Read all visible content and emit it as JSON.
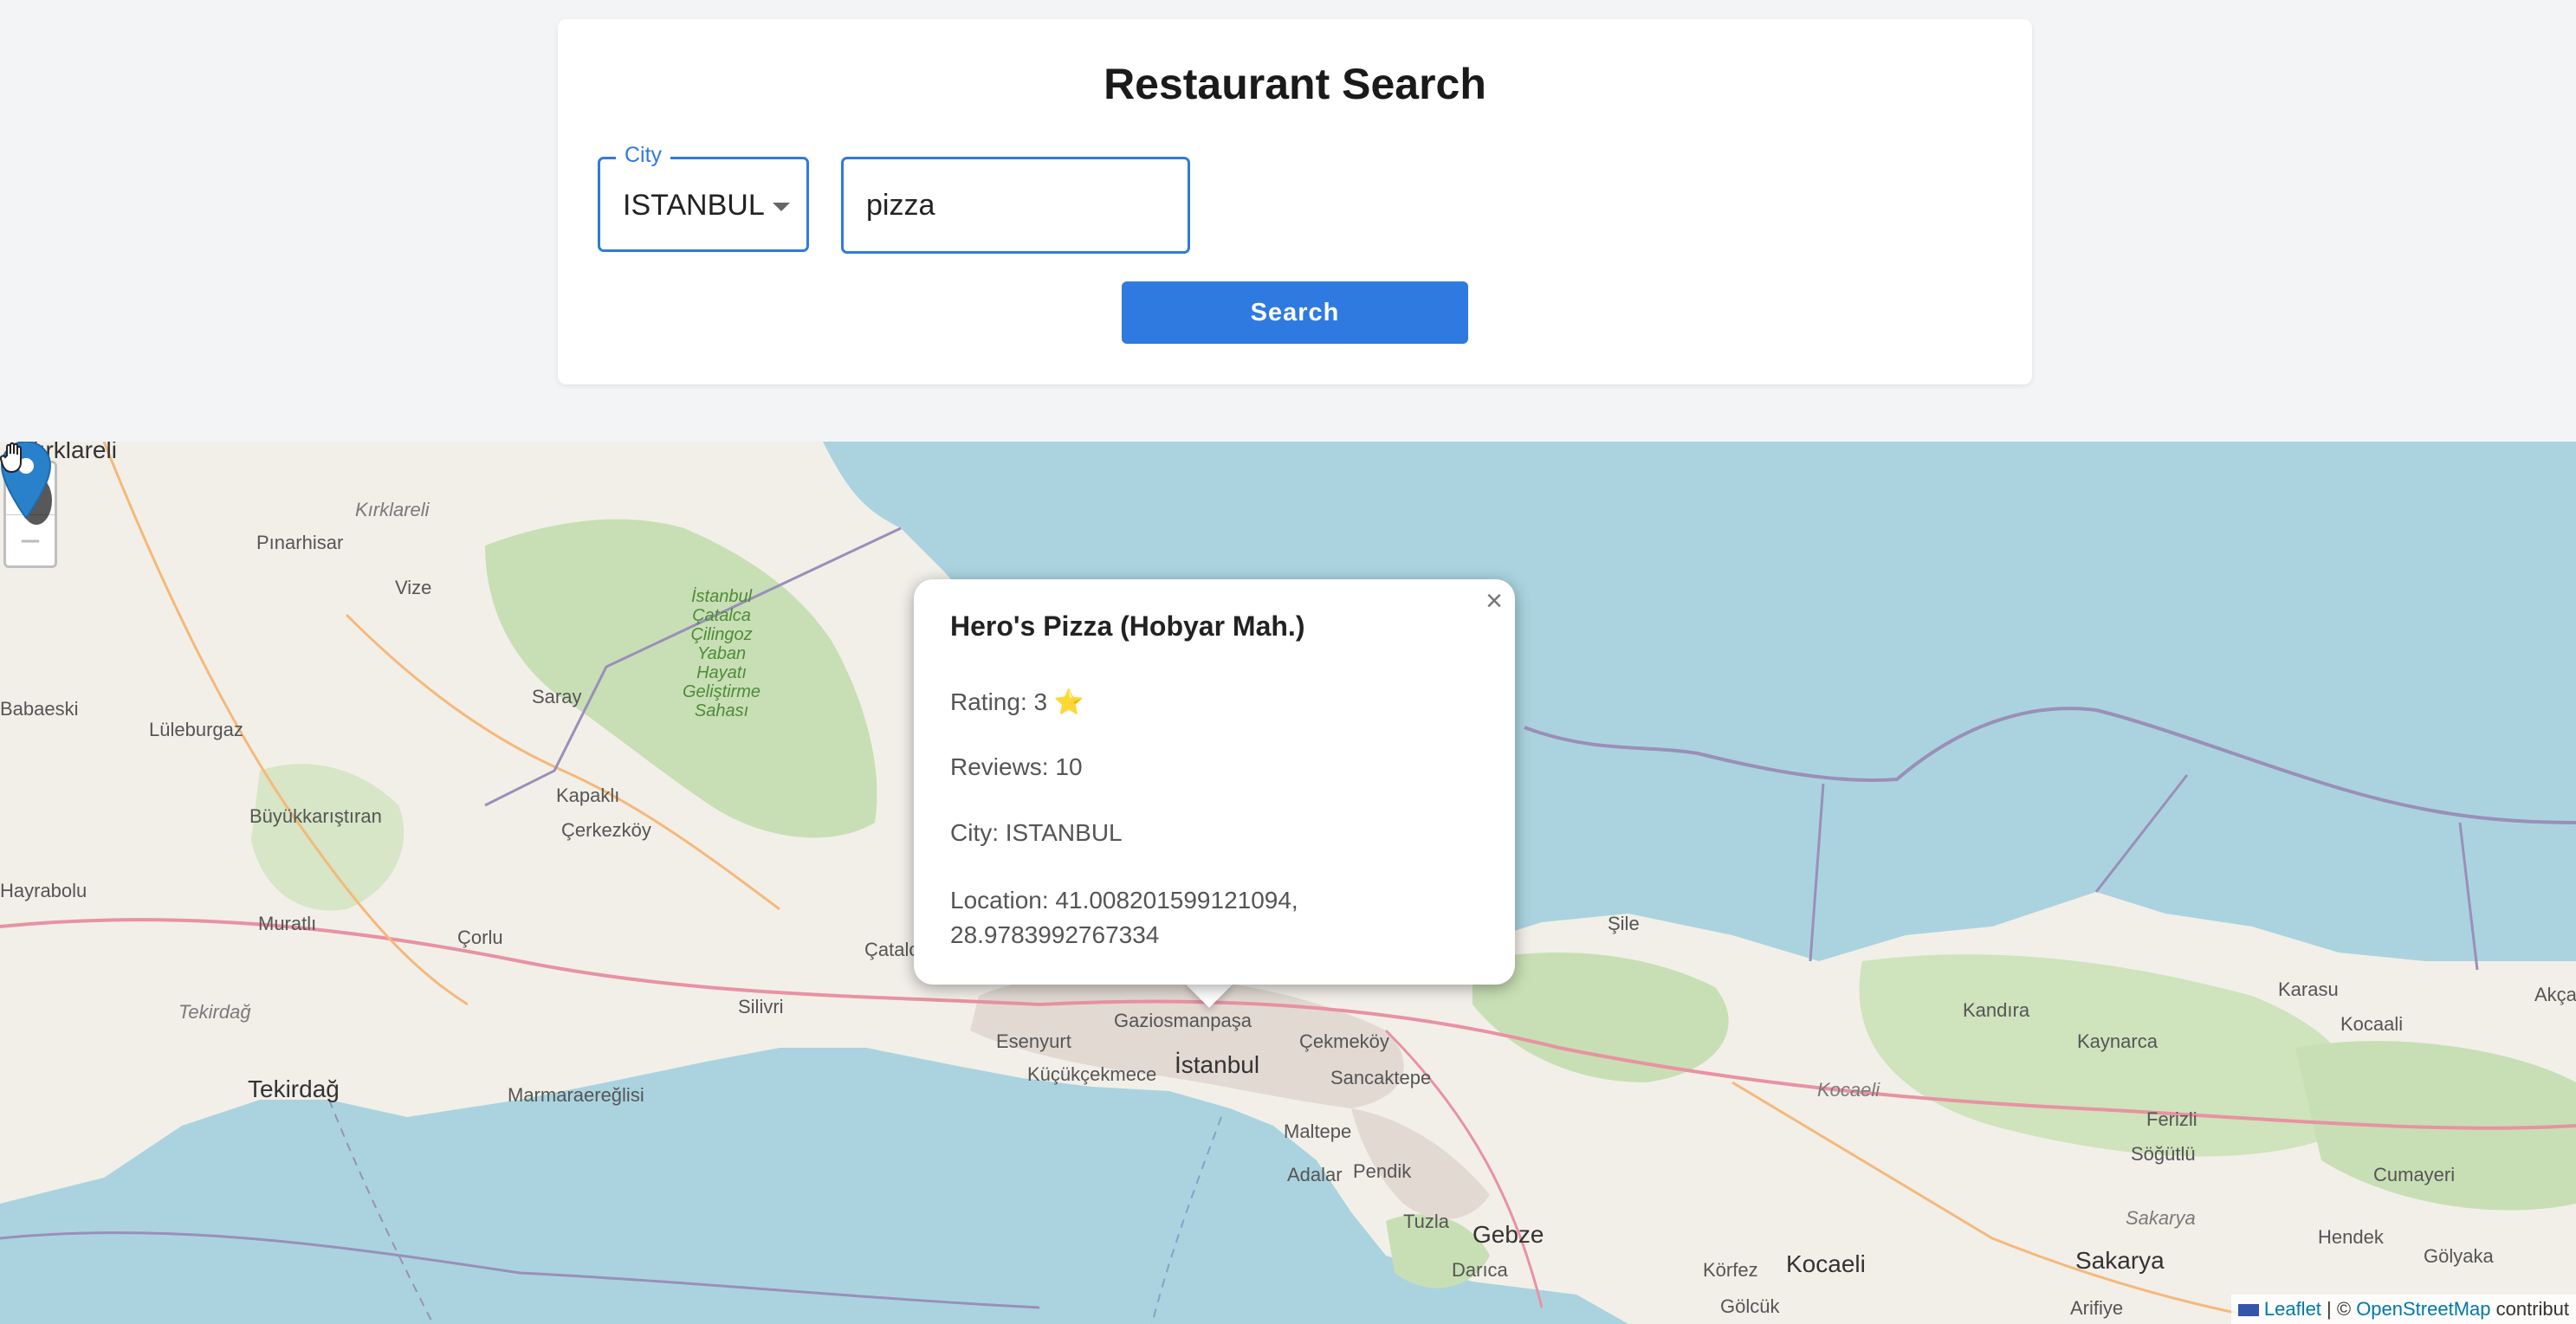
{
  "search": {
    "title": "Restaurant Search",
    "city_label": "City",
    "city_value": "ISTANBUL",
    "query_value": "pizza",
    "button_label": "Search"
  },
  "map": {
    "zoom_in": "+",
    "zoom_out": "−",
    "places": {
      "kirklareli": "Kırklareli",
      "kirklareli_prov": "Kırklareli",
      "pinarhisar": "Pınarhisar",
      "vize": "Vize",
      "saray": "Saray",
      "babaeski": "Babaeski",
      "luleburgaz": "Lüleburgaz",
      "buyukkaristiran": "Büyükkarıştıran",
      "kapakli": "Kapaklı",
      "cerkezkoy": "Çerkezköy",
      "hayrabolu": "Hayrabolu",
      "muratli": "Muratlı",
      "corlu": "Çorlu",
      "tekirdag_prov": "Tekirdağ",
      "tekirdag": "Tekirdağ",
      "marmaraereglisi": "Marmaraereğlisi",
      "silivri": "Silivri",
      "catalca": "Çatalca",
      "esenyurt": "Esenyurt",
      "kucukcekmece": "Küçükçekmece",
      "gaziosmanpasa": "Gaziosmanpaşa",
      "istanbul": "İstanbul",
      "cekmekoy": "Çekmeköy",
      "sancaktepe": "Sancaktepe",
      "maltepe": "Maltepe",
      "adalar": "Adalar",
      "pendik": "Pendik",
      "tuzla": "Tuzla",
      "gebze": "Gebze",
      "darica": "Darıca",
      "sile": "Şile",
      "kandira": "Kandıra",
      "kaynarca": "Kaynarca",
      "karasu": "Karasu",
      "kocaali": "Kocaali",
      "akcakoca": "Akçak",
      "kocaeli_prov": "Kocaeli",
      "kocaeli": "Kocaeli",
      "korfez": "Körfez",
      "sakarya_prov": "Sakarya",
      "sakarya": "Sakarya",
      "ferizli": "Ferizli",
      "sogutlu": "Söğütlü",
      "cumayeri": "Cumayeri",
      "hendek": "Hendek",
      "golyaka": "Gölyaka",
      "arifiye": "Arifiye",
      "golcuk": "Gölcük",
      "reserve": "İstanbul\nÇatalca\nÇilingoz\nYaban\nHayatı\nGeliştirme\nSahası"
    },
    "attribution": {
      "leaflet": "Leaflet",
      "separator": " | © ",
      "osm": "OpenStreetMap",
      "contrib": " contribut"
    }
  },
  "popup": {
    "close": "×",
    "name": "Hero's Pizza (Hobyar Mah.)",
    "rating": "Rating: 3 ⭐",
    "reviews": "Reviews: 10",
    "city": "City: ISTANBUL",
    "location_line1": "Location: 41.008201599121094,",
    "location_line2": "28.9783992767334"
  },
  "colors": {
    "accent": "#2f7ae0",
    "sea": "#aad3df",
    "land": "#f2efe9",
    "forest": "#c8dfb5",
    "marker": "#2a81cb"
  }
}
